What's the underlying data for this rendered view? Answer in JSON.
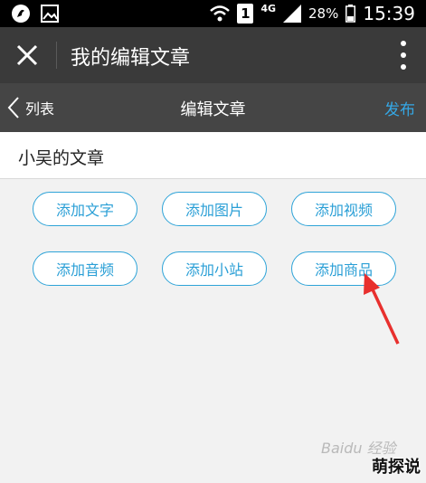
{
  "status_bar": {
    "network": "4G",
    "sim_label": "1",
    "battery": "28%",
    "time": "15:39",
    "icons": [
      "app-notification-icon",
      "image-notification-icon",
      "wifi-icon",
      "signal-icon",
      "battery-icon"
    ]
  },
  "app_bar": {
    "title": "我的编辑文章",
    "icons": [
      "close-icon",
      "more-vert-icon"
    ]
  },
  "nav_bar": {
    "back_label": "列表",
    "title": "编辑文章",
    "publish_label": "发布"
  },
  "article": {
    "title": "小吴的文章"
  },
  "actions": [
    {
      "label": "添加文字"
    },
    {
      "label": "添加图片"
    },
    {
      "label": "添加视频"
    },
    {
      "label": "添加音频"
    },
    {
      "label": "添加小站"
    },
    {
      "label": "添加商品"
    }
  ],
  "colors": {
    "accent": "#2fa4d8",
    "arrow": "#e8302e",
    "app_bar": "#3a3a3a",
    "nav_bar": "#454545"
  },
  "watermarks": {
    "baidu": "Baidu 经验",
    "site": "萌探说"
  }
}
